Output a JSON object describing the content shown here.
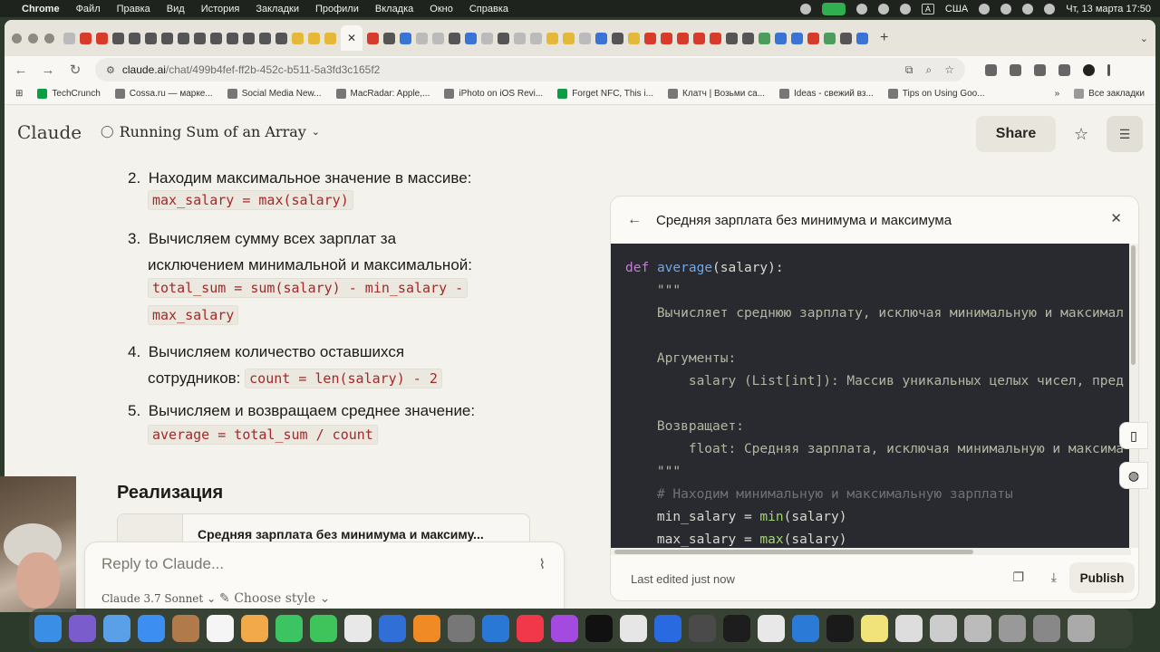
{
  "menubar": {
    "app": "Chrome",
    "items": [
      "Файл",
      "Правка",
      "Вид",
      "История",
      "Закладки",
      "Профили",
      "Вкладка",
      "Окно",
      "Справка"
    ],
    "input_source": "A",
    "region": "США",
    "datetime": "Чт, 13 марта  17:50"
  },
  "browser": {
    "url_host": "claude.ai",
    "url_path": "/chat/499b4fef-ff2b-452c-b511-5a3fd3c165f2",
    "bookmarks": [
      {
        "label": "TechCrunch",
        "icon": "tc-icon"
      },
      {
        "label": "Cossa.ru — марке...",
        "icon": "cossa-icon"
      },
      {
        "label": "Social Media New...",
        "icon": "social-icon"
      },
      {
        "label": "MacRadar: Apple,...",
        "icon": "macradar-icon"
      },
      {
        "label": "iPhoto on iOS Revi...",
        "icon": "iphoto-icon"
      },
      {
        "label": "Forget NFC, This i...",
        "icon": "tc-icon"
      },
      {
        "label": "Клатч | Возьми са...",
        "icon": "klatch-icon"
      },
      {
        "label": "Ideas - свежий вз...",
        "icon": "ideas-icon"
      },
      {
        "label": "Tips on Using Goo...",
        "icon": "tips-icon"
      }
    ],
    "bookmarks_more": "»",
    "all_bookmarks": "Все закладки"
  },
  "header": {
    "brand": "Claude",
    "conversation_title": "Running Sum of an Array",
    "share_label": "Share"
  },
  "steps": [
    {
      "num": "2.",
      "text": "Находим максимальное значение в массиве:",
      "code": "max_salary = max(salary)"
    },
    {
      "num": "3.",
      "text_line1": "Вычисляем сумму всех зарплат за",
      "text_line2": "исключением минимальной и максимальной:",
      "code_line1": "total_sum = sum(salary) - min_salary -",
      "code_line2": "max_salary"
    },
    {
      "num": "4.",
      "text_line1": "Вычисляем количество оставшихся",
      "text_line2": "сотрудников:",
      "code": "count = len(salary) - 2"
    },
    {
      "num": "5.",
      "text": "Вычисляем и возвращаем среднее значение:",
      "code": "average = total_sum / count"
    }
  ],
  "section_heading": "Реализация",
  "artifact_card_title": "Средняя зарплата без минимума и максиму...",
  "reply": {
    "placeholder": "Reply to Claude...",
    "model": "Claude 3.7 Sonnet",
    "style": "Choose style"
  },
  "artifact": {
    "title": "Средняя зарплата без минимума и максимума",
    "code": {
      "l1_def": "def",
      "l1_name": "average",
      "l1_rest": "(salary):",
      "l2": "    \"\"\"",
      "l3": "    Вычисляет среднюю зарплату, исключая минимальную и максимал",
      "l5": "    Аргументы:",
      "l6": "        salary (List[int]): Массив уникальных целых чисел, пред",
      "l8": "    Возвращает:",
      "l9": "        float: Средняя зарплата, исключая минимальную и максима",
      "l10": "    \"\"\"",
      "l11": "    # Находим минимальную и максимальную зарплаты",
      "l12_a": "    min_salary = ",
      "l12_b": "min",
      "l12_c": "(salary)",
      "l13_a": "    max_salary = ",
      "l13_b": "max",
      "l13_c": "(salary)"
    },
    "last_edited": "Last edited just now",
    "publish_label": "Publish"
  },
  "colors": {
    "page_bg": "#f4f2ec",
    "code_bg": "#282a30",
    "inline_code": "#a22929",
    "keyword": "#c57cd9",
    "function": "#6fa7e8",
    "builtin": "#a3d46b",
    "comment": "#6e7179"
  }
}
